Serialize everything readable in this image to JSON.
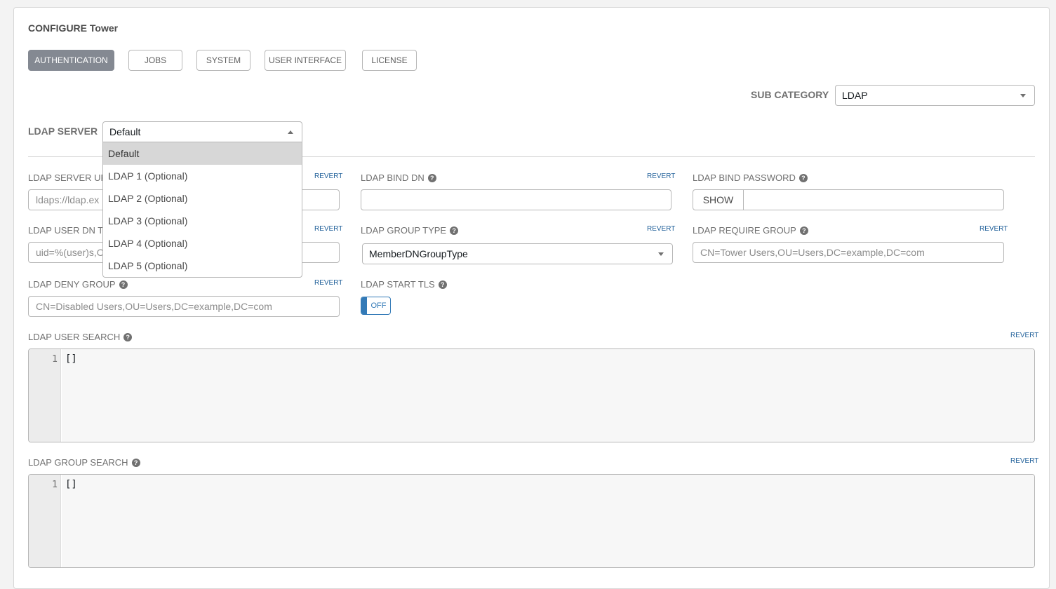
{
  "header": {
    "title": "CONFIGURE Tower"
  },
  "tabs": [
    {
      "label": "AUTHENTICATION",
      "active": true
    },
    {
      "label": "JOBS",
      "active": false
    },
    {
      "label": "SYSTEM",
      "active": false
    },
    {
      "label": "USER INTERFACE",
      "active": false
    },
    {
      "label": "LICENSE",
      "active": false
    }
  ],
  "sub_category": {
    "label": "SUB CATEGORY",
    "value": "LDAP"
  },
  "ldap_server": {
    "label": "LDAP SERVER",
    "value": "Default",
    "options": [
      "Default",
      "LDAP 1 (Optional)",
      "LDAP 2 (Optional)",
      "LDAP 3 (Optional)",
      "LDAP 4 (Optional)",
      "LDAP 5 (Optional)"
    ]
  },
  "revert_label": "REVERT",
  "fields": {
    "server_uri": {
      "label": "LDAP SERVER URI",
      "placeholder": "ldaps://ldap.ex"
    },
    "bind_dn": {
      "label": "LDAP BIND DN",
      "value": ""
    },
    "bind_password": {
      "label": "LDAP BIND PASSWORD",
      "show_label": "SHOW",
      "value": ""
    },
    "user_dn_template": {
      "label": "LDAP USER DN TE",
      "placeholder": "uid=%(user)s,C"
    },
    "group_type": {
      "label": "LDAP GROUP TYPE",
      "value": "MemberDNGroupType"
    },
    "require_group": {
      "label": "LDAP REQUIRE GROUP",
      "placeholder": "CN=Tower Users,OU=Users,DC=example,DC=com"
    },
    "deny_group": {
      "label": "LDAP DENY GROUP",
      "placeholder": "CN=Disabled Users,OU=Users,DC=example,DC=com"
    },
    "start_tls": {
      "label": "LDAP START TLS",
      "toggle_text": "OFF"
    },
    "user_search": {
      "label": "LDAP USER SEARCH",
      "line_number": "1",
      "code": "[]"
    },
    "group_search": {
      "label": "LDAP GROUP SEARCH",
      "line_number": "1",
      "code": "[]"
    }
  },
  "colors": {
    "accent": "#337ab7",
    "active_tab": "#848992",
    "revert_link": "#1f5f99"
  },
  "icons": {
    "help": "question-circle-icon",
    "caret": "caret-down-icon"
  }
}
